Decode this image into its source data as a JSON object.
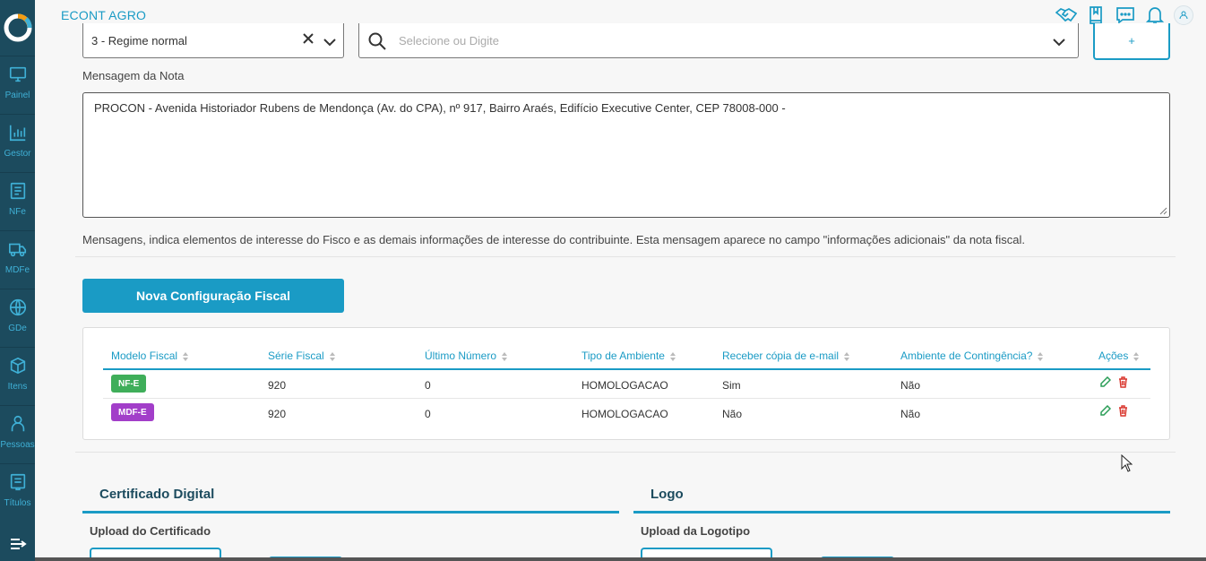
{
  "app": {
    "title": "ECONT AGRO"
  },
  "sidebar": {
    "items": [
      {
        "label": "Painel",
        "icon": "monitor-icon"
      },
      {
        "label": "Gestor",
        "icon": "bar-chart-icon"
      },
      {
        "label": "NFe",
        "icon": "receipt-icon"
      },
      {
        "label": "MDFe",
        "icon": "truck-icon"
      },
      {
        "label": "GDe",
        "icon": "globe-icon"
      },
      {
        "label": "Itens",
        "icon": "box-icon"
      },
      {
        "label": "Pessoas",
        "icon": "person-icon"
      },
      {
        "label": "Títulos",
        "icon": "document-icon"
      }
    ]
  },
  "form": {
    "regime_value": "3 - Regime normal",
    "search_placeholder": "Selecione ou Digite",
    "plus_label": "+",
    "message_label": "Mensagem da Nota",
    "message_value": "PROCON - Avenida Historiador Rubens de Mendonça (Av. do CPA), nº 917, Bairro Araés, Edifício Executive Center, CEP 78008-000 -",
    "help_text": "Mensagens, indica elementos de interesse do Fisco e as demais informações de interesse do contribuinte. Esta mensagem aparece no campo \"informações adicionais\" da nota fiscal."
  },
  "fiscal": {
    "new_button": "Nova Configuração Fiscal",
    "columns": [
      "Modelo Fiscal",
      "Série Fiscal",
      "Último Número",
      "Tipo de Ambiente",
      "Receber cópia de e-mail",
      "Ambiente de Contingência?",
      "Ações"
    ],
    "rows": [
      {
        "modelo": "NF-E",
        "badge_color": "#3fae5a",
        "serie": "920",
        "ultimo": "0",
        "ambiente": "HOMOLOGACAO",
        "copia": "Sim",
        "contingencia": "Não"
      },
      {
        "modelo": "MDF-E",
        "badge_color": "#a23ec9",
        "serie": "920",
        "ultimo": "0",
        "ambiente": "HOMOLOGACAO",
        "copia": "Não",
        "contingencia": "Não"
      }
    ]
  },
  "certificado": {
    "title": "Certificado Digital",
    "upload_label": "Upload do Certificado"
  },
  "logo_section": {
    "title": "Logo",
    "upload_label": "Upload da Logotipo"
  },
  "colors": {
    "accent": "#1a9bc5",
    "sidebar": "#1c4b5e",
    "danger": "#d9342b",
    "edit": "#2a9d57"
  }
}
